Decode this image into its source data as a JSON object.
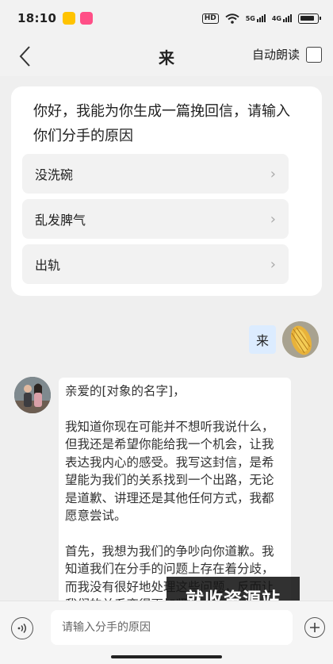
{
  "status_bar": {
    "time": "18:10",
    "hd": "HD",
    "net1": "5G",
    "net2": "4G"
  },
  "header": {
    "title": "来",
    "auto_read_label": "自动朗读"
  },
  "intro": {
    "prompt": "你好，我能为你生成一篇挽回信，请输入你们分手的原因",
    "reasons": [
      "没洗碗",
      "乱发脾气",
      "出轨"
    ]
  },
  "user_message": {
    "text": "来"
  },
  "bot_message": {
    "paragraphs": [
      "亲爱的[对象的名字]，",
      "我知道你现在可能并不想听我说什么，但我还是希望你能给我一个机会，让我表达我内心的感受。我写这封信，是希望能为我们的关系找到一个出路，无论是道歉、讲理还是其他任何方式，我都愿意尝试。",
      "首先，我想为我们的争吵向你道歉。我知道我们在分手的问题上存在着分歧，而我没有很好地处理这些问题，反而让我们的关系变得更加紧张。"
    ]
  },
  "watermark": {
    "text": "就收资源站"
  },
  "input": {
    "placeholder": "请输入分手的原因"
  }
}
